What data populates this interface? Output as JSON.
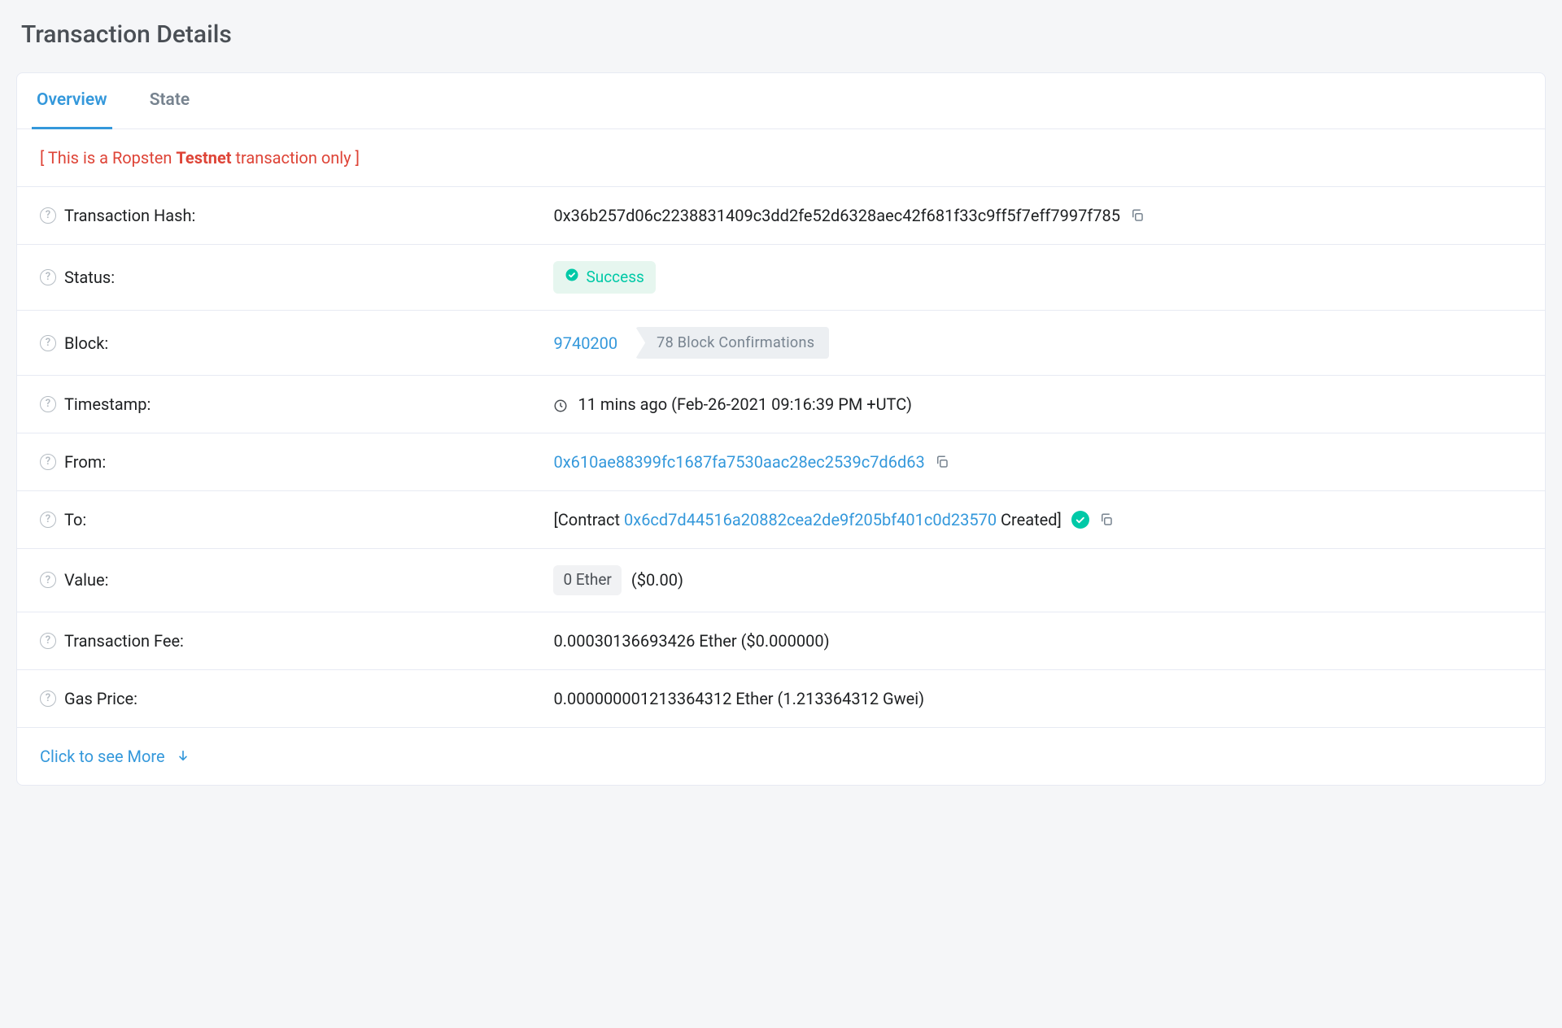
{
  "page": {
    "title": "Transaction Details"
  },
  "tabs": {
    "overview": "Overview",
    "state": "State"
  },
  "notice": {
    "prefix": "[ This is a Ropsten ",
    "bold": "Testnet",
    "suffix": " transaction only ]"
  },
  "rows": {
    "txHash": {
      "label": "Transaction Hash:",
      "value": "0x36b257d06c2238831409c3dd2fe52d6328aec42f681f33c9ff5f7eff7997f785"
    },
    "status": {
      "label": "Status:",
      "value": "Success"
    },
    "block": {
      "label": "Block:",
      "number": "9740200",
      "confirmations": "78 Block Confirmations"
    },
    "timestamp": {
      "label": "Timestamp:",
      "value": "11 mins ago (Feb-26-2021 09:16:39 PM +UTC)"
    },
    "from": {
      "label": "From:",
      "address": "0x610ae88399fc1687fa7530aac28ec2539c7d6d63"
    },
    "to": {
      "label": "To:",
      "prefix": "[Contract ",
      "address": "0x6cd7d44516a20882cea2de9f205bf401c0d23570",
      "suffix": " Created]"
    },
    "value": {
      "label": "Value:",
      "ether": "0 Ether",
      "usd": "($0.00)"
    },
    "txFee": {
      "label": "Transaction Fee:",
      "value": "0.00030136693426 Ether ($0.000000)"
    },
    "gasPrice": {
      "label": "Gas Price:",
      "value": "0.000000001213364312 Ether (1.213364312 Gwei)"
    }
  },
  "seeMore": "Click to see More"
}
